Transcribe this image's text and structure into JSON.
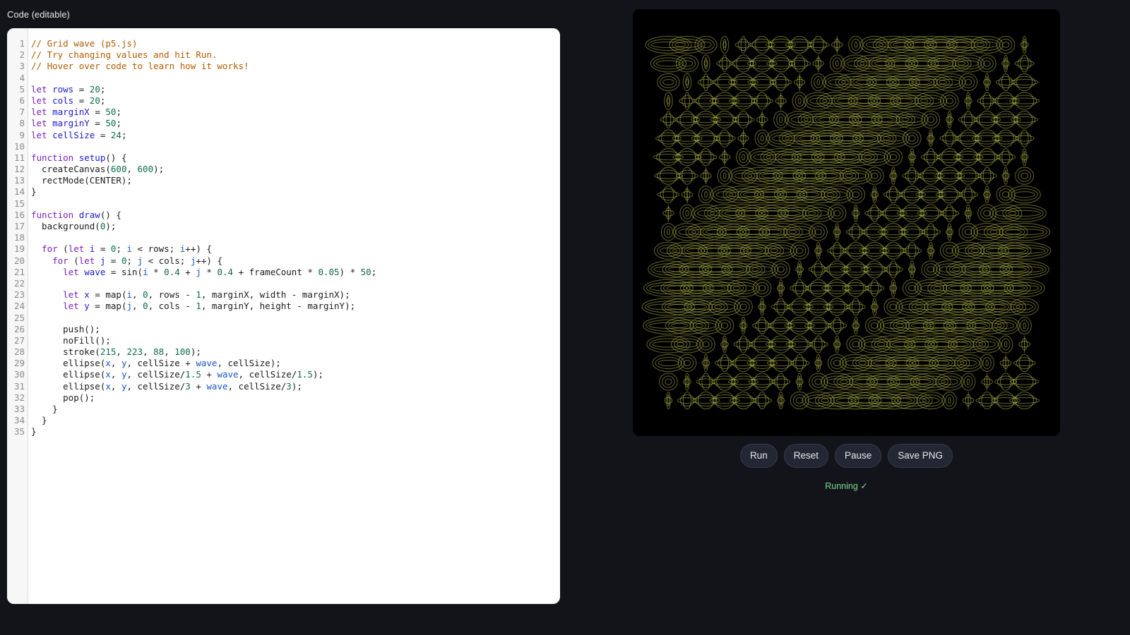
{
  "editor": {
    "title": "Code (editable)",
    "lines": [
      [
        {
          "t": "// Grid wave (p5.js)",
          "c": "comment"
        }
      ],
      [
        {
          "t": "// Try changing values and hit Run.",
          "c": "comment"
        }
      ],
      [
        {
          "t": "// Hover over code to learn how it works!",
          "c": "comment"
        }
      ],
      [],
      [
        {
          "t": "let ",
          "c": "kw"
        },
        {
          "t": "rows",
          "c": "def"
        },
        {
          "t": " = ",
          "c": "plain"
        },
        {
          "t": "20",
          "c": "num"
        },
        {
          "t": ";",
          "c": "plain"
        }
      ],
      [
        {
          "t": "let ",
          "c": "kw"
        },
        {
          "t": "cols",
          "c": "def"
        },
        {
          "t": " = ",
          "c": "plain"
        },
        {
          "t": "20",
          "c": "num"
        },
        {
          "t": ";",
          "c": "plain"
        }
      ],
      [
        {
          "t": "let ",
          "c": "kw"
        },
        {
          "t": "marginX",
          "c": "def"
        },
        {
          "t": " = ",
          "c": "plain"
        },
        {
          "t": "50",
          "c": "num"
        },
        {
          "t": ";",
          "c": "plain"
        }
      ],
      [
        {
          "t": "let ",
          "c": "kw"
        },
        {
          "t": "marginY",
          "c": "def"
        },
        {
          "t": " = ",
          "c": "plain"
        },
        {
          "t": "50",
          "c": "num"
        },
        {
          "t": ";",
          "c": "plain"
        }
      ],
      [
        {
          "t": "let ",
          "c": "kw"
        },
        {
          "t": "cellSize",
          "c": "def"
        },
        {
          "t": " = ",
          "c": "plain"
        },
        {
          "t": "24",
          "c": "num"
        },
        {
          "t": ";",
          "c": "plain"
        }
      ],
      [],
      [
        {
          "t": "function ",
          "c": "kw"
        },
        {
          "t": "setup",
          "c": "def"
        },
        {
          "t": "() {",
          "c": "plain"
        }
      ],
      [
        {
          "t": "  createCanvas(",
          "c": "plain"
        },
        {
          "t": "600",
          "c": "num"
        },
        {
          "t": ", ",
          "c": "plain"
        },
        {
          "t": "600",
          "c": "num"
        },
        {
          "t": ");",
          "c": "plain"
        }
      ],
      [
        {
          "t": "  rectMode(CENTER);",
          "c": "plain"
        }
      ],
      [
        {
          "t": "}",
          "c": "plain"
        }
      ],
      [],
      [
        {
          "t": "function ",
          "c": "kw"
        },
        {
          "t": "draw",
          "c": "def"
        },
        {
          "t": "() {",
          "c": "plain"
        }
      ],
      [
        {
          "t": "  background(",
          "c": "plain"
        },
        {
          "t": "0",
          "c": "num"
        },
        {
          "t": ");",
          "c": "plain"
        }
      ],
      [],
      [
        {
          "t": "  for ",
          "c": "kw"
        },
        {
          "t": "(",
          "c": "plain"
        },
        {
          "t": "let ",
          "c": "kw"
        },
        {
          "t": "i",
          "c": "def"
        },
        {
          "t": " = ",
          "c": "plain"
        },
        {
          "t": "0",
          "c": "num"
        },
        {
          "t": "; ",
          "c": "plain"
        },
        {
          "t": "i",
          "c": "var"
        },
        {
          "t": " < rows; ",
          "c": "plain"
        },
        {
          "t": "i",
          "c": "var"
        },
        {
          "t": "++) {",
          "c": "plain"
        }
      ],
      [
        {
          "t": "    for ",
          "c": "kw"
        },
        {
          "t": "(",
          "c": "plain"
        },
        {
          "t": "let ",
          "c": "kw"
        },
        {
          "t": "j",
          "c": "def"
        },
        {
          "t": " = ",
          "c": "plain"
        },
        {
          "t": "0",
          "c": "num"
        },
        {
          "t": "; ",
          "c": "plain"
        },
        {
          "t": "j",
          "c": "var"
        },
        {
          "t": " < cols; ",
          "c": "plain"
        },
        {
          "t": "j",
          "c": "var"
        },
        {
          "t": "++) {",
          "c": "plain"
        }
      ],
      [
        {
          "t": "      let ",
          "c": "kw"
        },
        {
          "t": "wave",
          "c": "def"
        },
        {
          "t": " = sin(",
          "c": "plain"
        },
        {
          "t": "i",
          "c": "var"
        },
        {
          "t": " * ",
          "c": "plain"
        },
        {
          "t": "0.4",
          "c": "num"
        },
        {
          "t": " + ",
          "c": "plain"
        },
        {
          "t": "j",
          "c": "var"
        },
        {
          "t": " * ",
          "c": "plain"
        },
        {
          "t": "0.4",
          "c": "num"
        },
        {
          "t": " + frameCount * ",
          "c": "plain"
        },
        {
          "t": "0.05",
          "c": "num"
        },
        {
          "t": ") * ",
          "c": "plain"
        },
        {
          "t": "50",
          "c": "num"
        },
        {
          "t": ";",
          "c": "plain"
        }
      ],
      [],
      [
        {
          "t": "      let ",
          "c": "kw"
        },
        {
          "t": "x",
          "c": "def"
        },
        {
          "t": " = map(",
          "c": "plain"
        },
        {
          "t": "i",
          "c": "var"
        },
        {
          "t": ", ",
          "c": "plain"
        },
        {
          "t": "0",
          "c": "num"
        },
        {
          "t": ", rows - ",
          "c": "plain"
        },
        {
          "t": "1",
          "c": "num"
        },
        {
          "t": ", marginX, width - marginX);",
          "c": "plain"
        }
      ],
      [
        {
          "t": "      let ",
          "c": "kw"
        },
        {
          "t": "y",
          "c": "def"
        },
        {
          "t": " = map(",
          "c": "plain"
        },
        {
          "t": "j",
          "c": "var"
        },
        {
          "t": ", ",
          "c": "plain"
        },
        {
          "t": "0",
          "c": "num"
        },
        {
          "t": ", cols - ",
          "c": "plain"
        },
        {
          "t": "1",
          "c": "num"
        },
        {
          "t": ", marginY, height - marginY);",
          "c": "plain"
        }
      ],
      [],
      [
        {
          "t": "      push();",
          "c": "plain"
        }
      ],
      [
        {
          "t": "      noFill();",
          "c": "plain"
        }
      ],
      [
        {
          "t": "      stroke(",
          "c": "plain"
        },
        {
          "t": "215",
          "c": "num"
        },
        {
          "t": ", ",
          "c": "plain"
        },
        {
          "t": "223",
          "c": "num"
        },
        {
          "t": ", ",
          "c": "plain"
        },
        {
          "t": "88",
          "c": "num"
        },
        {
          "t": ", ",
          "c": "plain"
        },
        {
          "t": "100",
          "c": "num"
        },
        {
          "t": ");",
          "c": "plain"
        }
      ],
      [
        {
          "t": "      ellipse(",
          "c": "plain"
        },
        {
          "t": "x",
          "c": "var"
        },
        {
          "t": ", ",
          "c": "plain"
        },
        {
          "t": "y",
          "c": "var"
        },
        {
          "t": ", cellSize + ",
          "c": "plain"
        },
        {
          "t": "wave",
          "c": "var"
        },
        {
          "t": ", cellSize);",
          "c": "plain"
        }
      ],
      [
        {
          "t": "      ellipse(",
          "c": "plain"
        },
        {
          "t": "x",
          "c": "var"
        },
        {
          "t": ", ",
          "c": "plain"
        },
        {
          "t": "y",
          "c": "var"
        },
        {
          "t": ", cellSize/",
          "c": "plain"
        },
        {
          "t": "1.5",
          "c": "num"
        },
        {
          "t": " + ",
          "c": "plain"
        },
        {
          "t": "wave",
          "c": "var"
        },
        {
          "t": ", cellSize/",
          "c": "plain"
        },
        {
          "t": "1.5",
          "c": "num"
        },
        {
          "t": ");",
          "c": "plain"
        }
      ],
      [
        {
          "t": "      ellipse(",
          "c": "plain"
        },
        {
          "t": "x",
          "c": "var"
        },
        {
          "t": ", ",
          "c": "plain"
        },
        {
          "t": "y",
          "c": "var"
        },
        {
          "t": ", cellSize/",
          "c": "plain"
        },
        {
          "t": "3",
          "c": "num"
        },
        {
          "t": " + ",
          "c": "plain"
        },
        {
          "t": "wave",
          "c": "var"
        },
        {
          "t": ", cellSize/",
          "c": "plain"
        },
        {
          "t": "3",
          "c": "num"
        },
        {
          "t": ");",
          "c": "plain"
        }
      ],
      [
        {
          "t": "      pop();",
          "c": "plain"
        }
      ],
      [
        {
          "t": "    }",
          "c": "plain"
        }
      ],
      [
        {
          "t": "  }",
          "c": "plain"
        }
      ],
      [
        {
          "t": "}",
          "c": "plain"
        }
      ]
    ]
  },
  "sketch": {
    "rows": 20,
    "cols": 20,
    "cell_size": 24,
    "wave_amplitude": 50,
    "wave_step": 0.4,
    "phase": 2.2,
    "stroke_color": "#d7df58",
    "stroke_opacity": 0.45,
    "background_color": "#000000"
  },
  "controls": {
    "run_label": "Run",
    "reset_label": "Reset",
    "pause_label": "Pause",
    "save_label": "Save PNG"
  },
  "status": {
    "text": "Running ✓",
    "color": "#7fd98f"
  }
}
